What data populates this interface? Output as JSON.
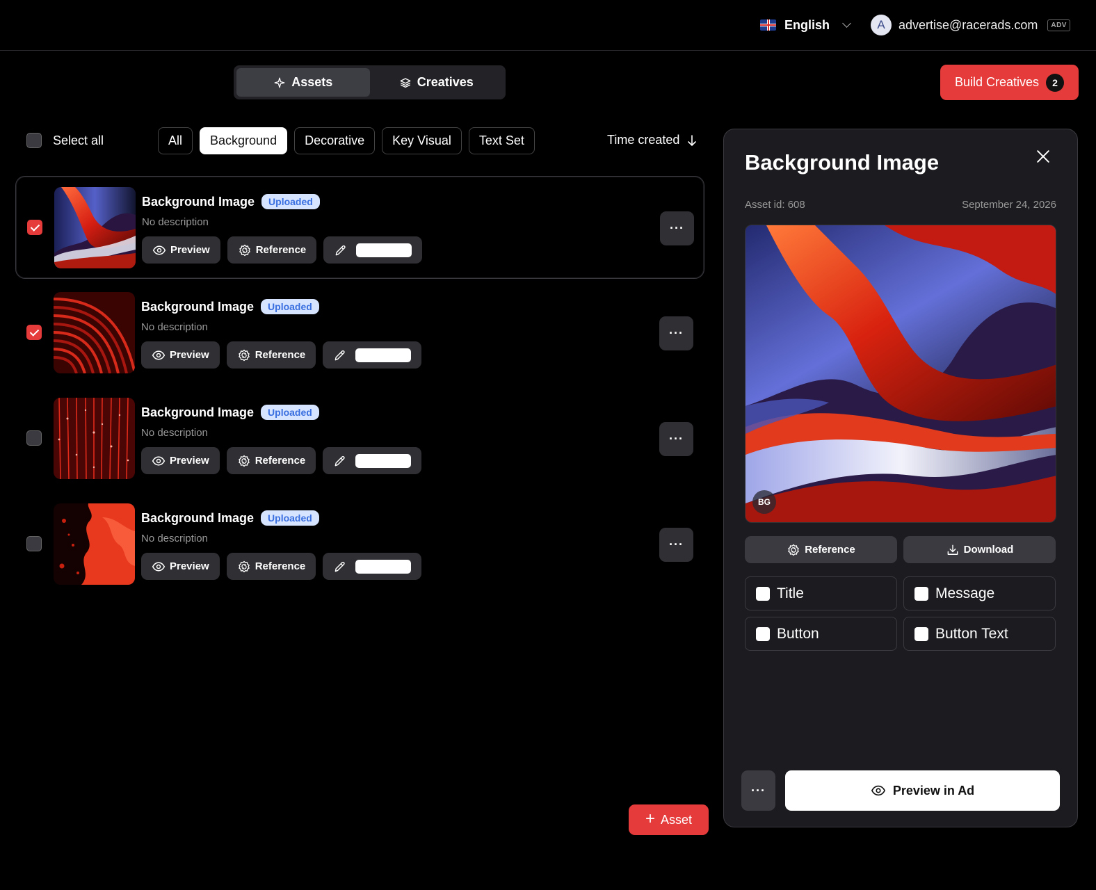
{
  "header": {
    "language": "English",
    "user_initial": "A",
    "user_email": "advertise@racerads.com",
    "user_role": "ADV"
  },
  "tabs": [
    {
      "label": "Assets",
      "active": true,
      "icon": "sparkle-icon"
    },
    {
      "label": "Creatives",
      "active": false,
      "icon": "layers-icon"
    }
  ],
  "build": {
    "label": "Build Creatives",
    "count": "2"
  },
  "filters": {
    "select_all": "Select all",
    "chips": [
      "All",
      "Background",
      "Decorative",
      "Key Visual",
      "Text Set"
    ],
    "active_chip": "Background",
    "sort_label": "Time created"
  },
  "assets": [
    {
      "title": "Background Image",
      "status": "Uploaded",
      "description": "No description",
      "checked": true,
      "preview": "Preview",
      "reference": "Reference"
    },
    {
      "title": "Background Image",
      "status": "Uploaded",
      "description": "No description",
      "checked": true,
      "preview": "Preview",
      "reference": "Reference"
    },
    {
      "title": "Background Image",
      "status": "Uploaded",
      "description": "No description",
      "checked": false,
      "preview": "Preview",
      "reference": "Reference"
    },
    {
      "title": "Background Image",
      "status": "Uploaded",
      "description": "No description",
      "checked": false,
      "preview": "Preview",
      "reference": "Reference"
    }
  ],
  "add_asset": "Asset",
  "panel": {
    "title": "Background Image",
    "asset_id": "Asset id: 608",
    "date": "September 24, 2026",
    "image_tag": "BG",
    "reference": "Reference",
    "download": "Download",
    "options": [
      "Title",
      "Message",
      "Button",
      "Button Text"
    ],
    "preview_in_ad": "Preview in Ad",
    "more": "···"
  },
  "colors": {
    "accent": "#e63b3b",
    "badge_bg": "#d6e4ff",
    "badge_text": "#3a6fe0"
  }
}
